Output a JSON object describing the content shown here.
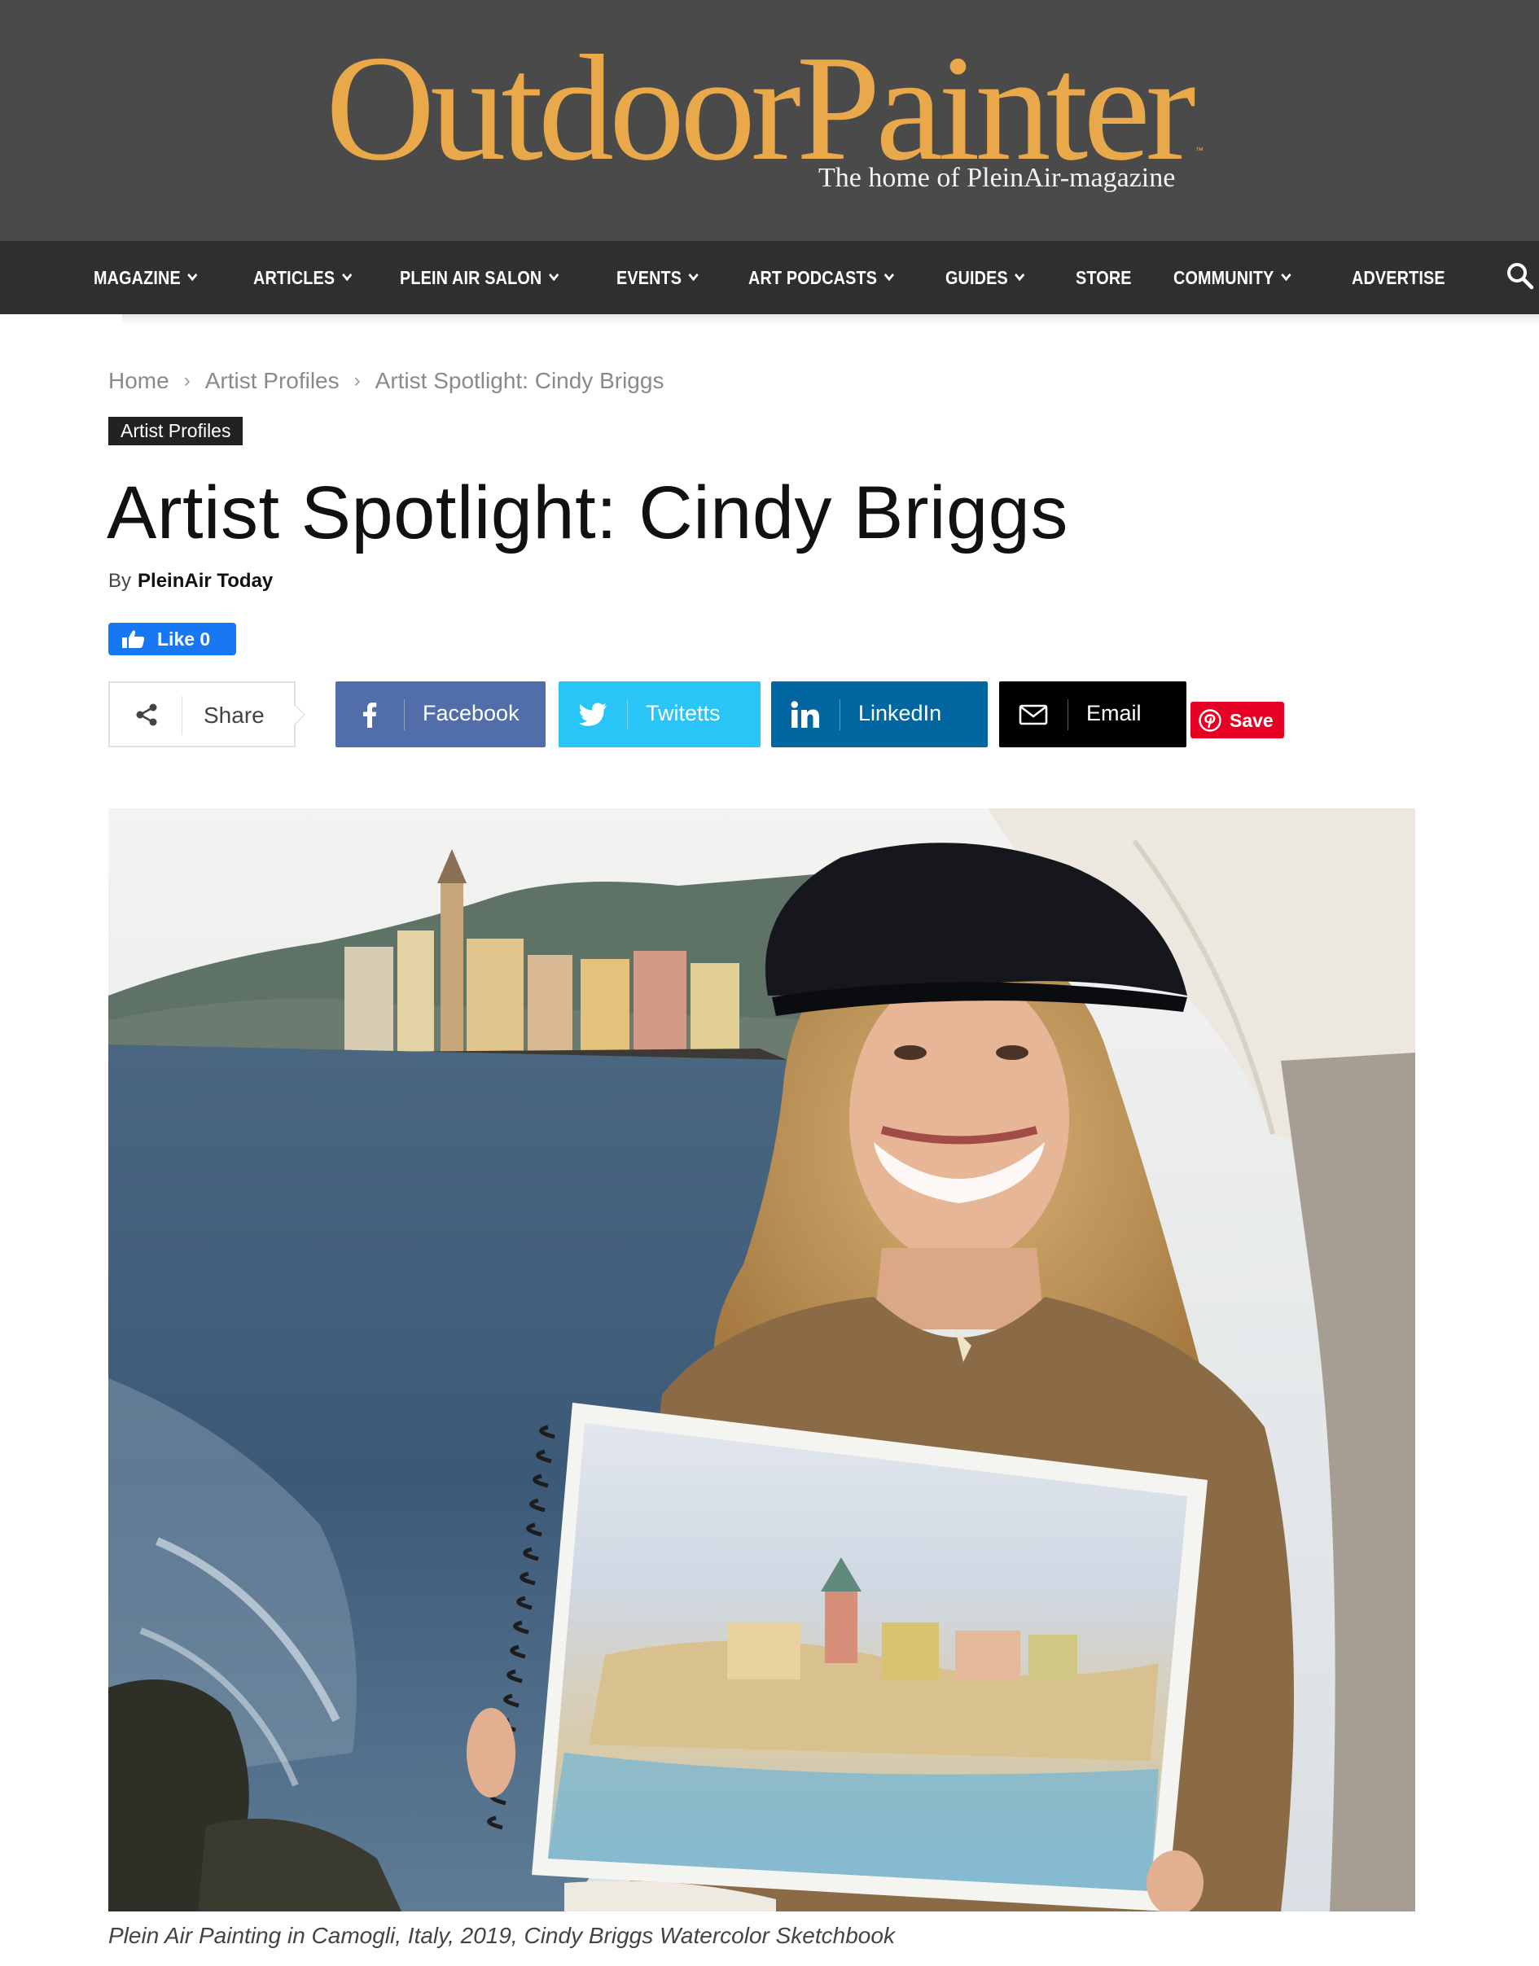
{
  "header": {
    "logo_text": "OutdoorPainter",
    "tagline": "The home of PleinAir-magazine",
    "logo_color": "#e9a94a",
    "bg_color": "#4a4a4a"
  },
  "nav": {
    "bg_color": "#2f2f2f",
    "items": [
      {
        "label": "MAGAZINE",
        "has_dropdown": true
      },
      {
        "label": "ARTICLES",
        "has_dropdown": true
      },
      {
        "label": "PLEIN AIR SALON",
        "has_dropdown": true
      },
      {
        "label": "EVENTS",
        "has_dropdown": true
      },
      {
        "label": "ART PODCASTS",
        "has_dropdown": true
      },
      {
        "label": "GUIDES",
        "has_dropdown": true
      },
      {
        "label": "STORE",
        "has_dropdown": false
      },
      {
        "label": "COMMUNITY",
        "has_dropdown": true
      },
      {
        "label": "ADVERTISE",
        "has_dropdown": false
      }
    ],
    "search_icon": "search-icon"
  },
  "breadcrumb": {
    "items": [
      "Home",
      "Artist Profiles",
      "Artist Spotlight: Cindy Briggs"
    ],
    "separator": "›"
  },
  "article": {
    "category": "Artist Profiles",
    "title": "Artist Spotlight: Cindy Briggs",
    "by_label": "By",
    "author": "PleinAir Today",
    "like_label": "Like 0",
    "image_caption": "Plein Air Painting in Camogli, Italy, 2019, Cindy Briggs Watercolor Sketchbook"
  },
  "share": {
    "label": "Share",
    "buttons": [
      {
        "label": "Facebook",
        "icon": "facebook-icon",
        "color": "#516eab"
      },
      {
        "label": "Twitetts",
        "icon": "twitter-icon",
        "color": "#29c5f6"
      },
      {
        "label": "LinkedIn",
        "icon": "linkedin-icon",
        "color": "#0266a0"
      },
      {
        "label": "Email",
        "icon": "email-icon",
        "color": "#000000"
      }
    ],
    "save_label": "Save",
    "save_color": "#e60023"
  }
}
